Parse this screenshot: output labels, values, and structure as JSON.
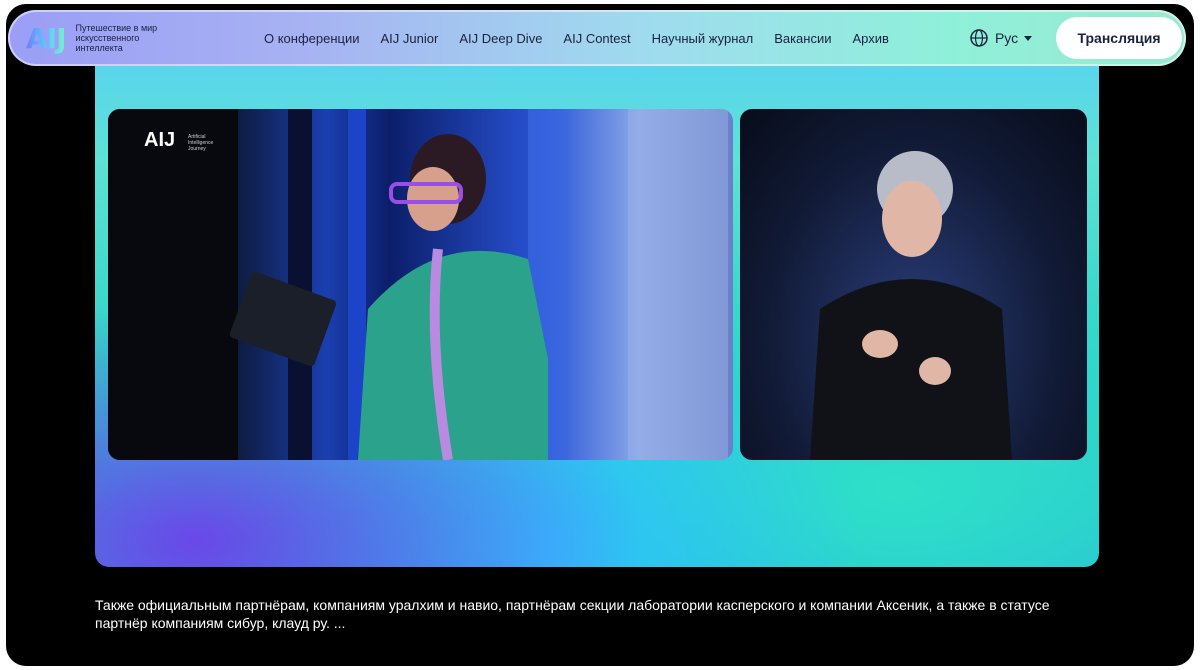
{
  "header": {
    "logo": "AIJ",
    "logo_text": "Путешествие в мир искусственного интеллекта",
    "nav": [
      "О конференции",
      "AIJ Junior",
      "AIJ Deep Dive",
      "AIJ Contest",
      "Научный журнал",
      "Вакансии",
      "Архив"
    ],
    "lang": "Рус",
    "live_button": "Трансляция"
  },
  "player": {
    "main_video_logo": "AIJ",
    "main_video_logo_sub": "Artificial Intelligence Journey"
  },
  "caption": "Также официальным партнёрам, компаниям уралхим и навио, партнёрам секции лаборатории касперского и компании Аксеник, а также в статусе партнёр компаниям сибур, клауд ру. ..."
}
